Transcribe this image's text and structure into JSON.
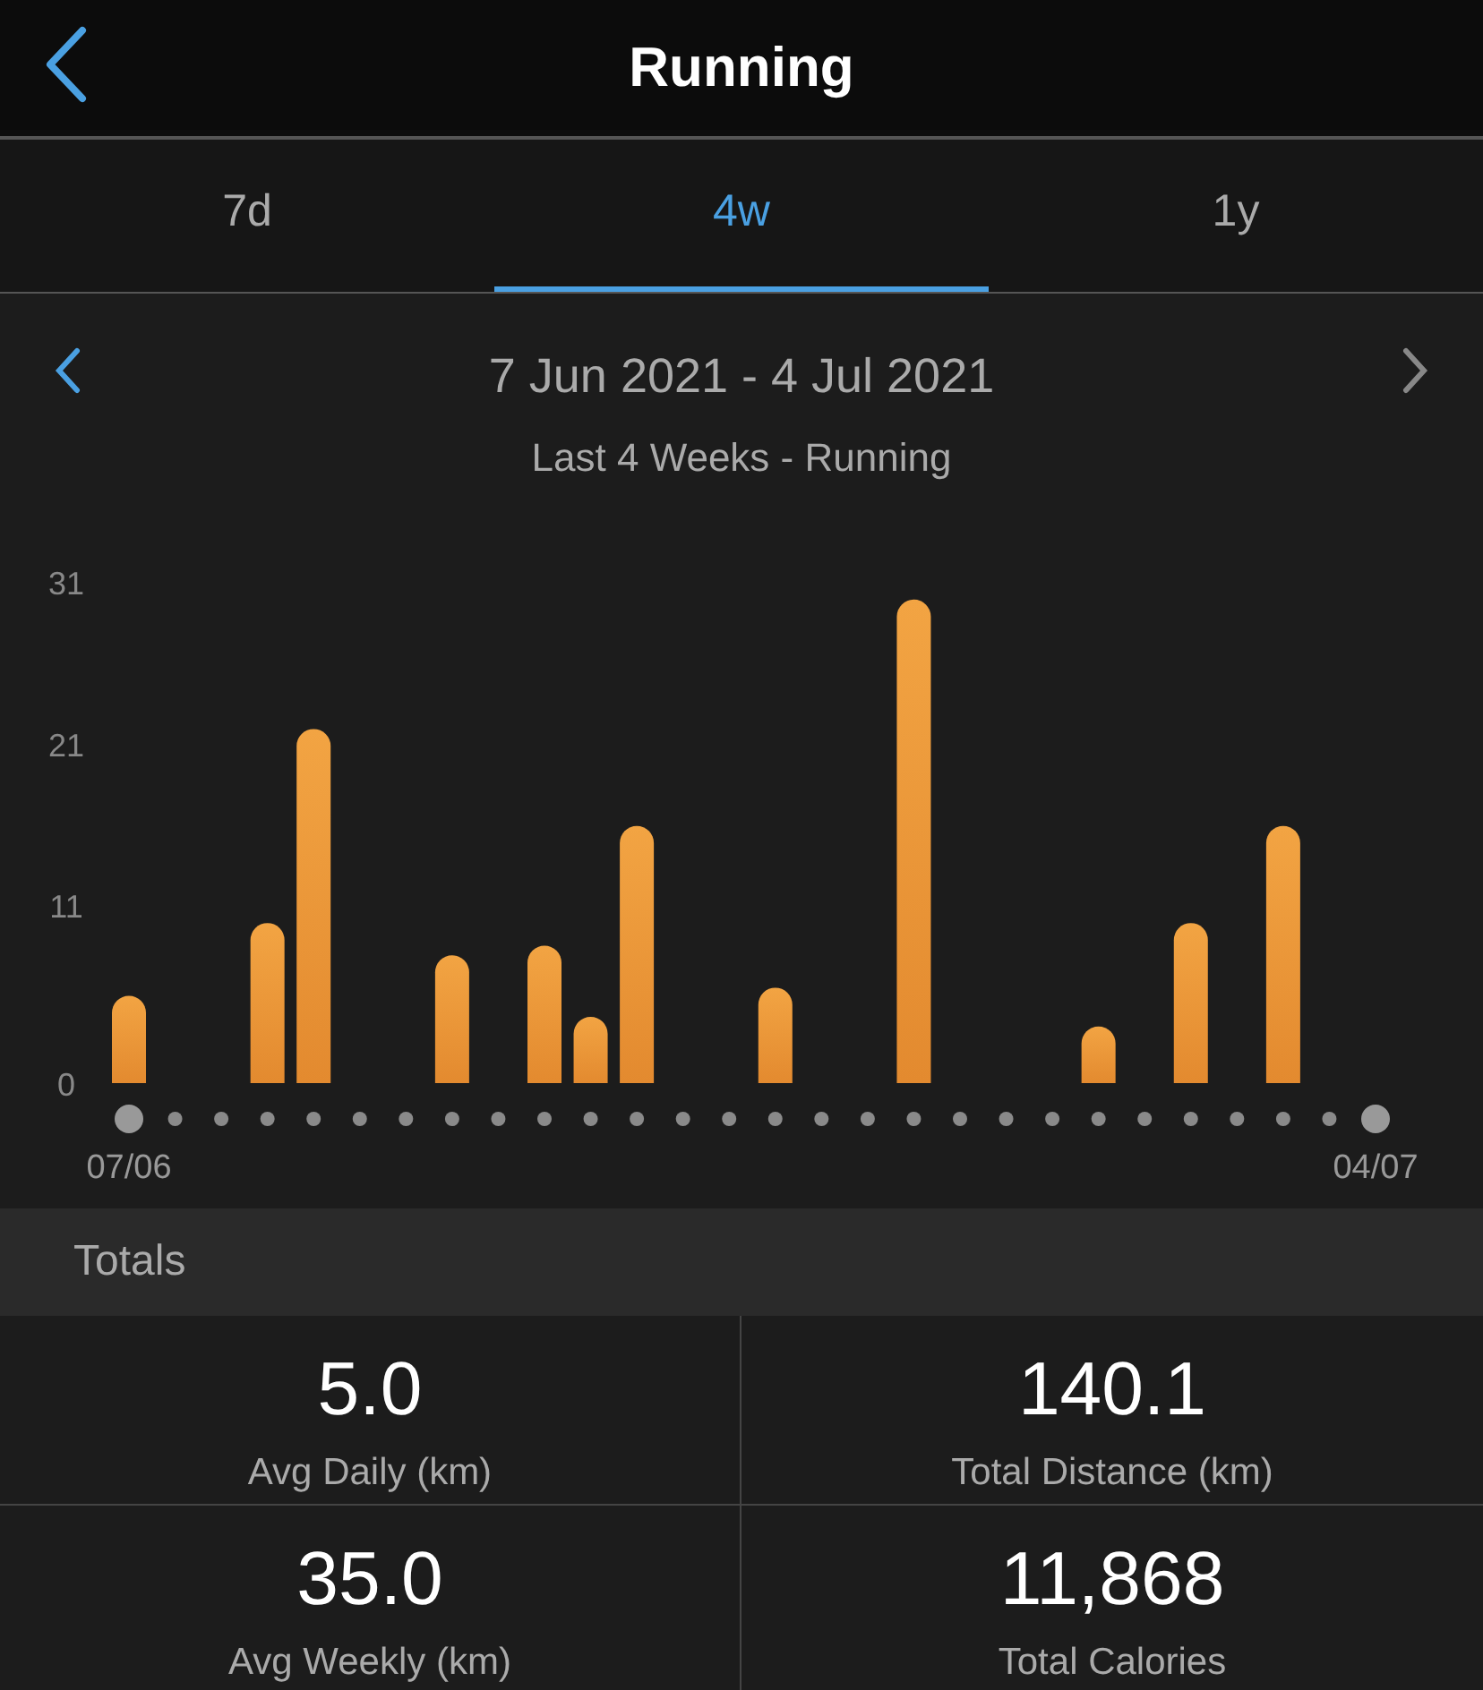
{
  "header": {
    "title": "Running"
  },
  "tabs": [
    {
      "label": "7d",
      "selected": false
    },
    {
      "label": "4w",
      "selected": true
    },
    {
      "label": "1y",
      "selected": false
    }
  ],
  "period": {
    "range": "7 Jun 2021 - 4 Jul 2021",
    "subtitle": "Last 4 Weeks - Running"
  },
  "chart_data": {
    "type": "bar",
    "categories": [
      "07/06",
      null,
      null,
      null,
      null,
      null,
      null,
      null,
      null,
      null,
      null,
      null,
      null,
      null,
      null,
      null,
      null,
      null,
      null,
      null,
      null,
      null,
      null,
      null,
      null,
      null,
      null,
      "04/07"
    ],
    "values": [
      5.4,
      null,
      null,
      9.9,
      21.9,
      null,
      null,
      7.9,
      null,
      8.5,
      4.1,
      15.9,
      null,
      null,
      5.9,
      null,
      null,
      29.9,
      null,
      null,
      null,
      3.5,
      null,
      9.9,
      null,
      15.9,
      null,
      null
    ],
    "ylim": [
      0,
      31
    ],
    "yticks": [
      0,
      11,
      21,
      31
    ]
  },
  "totals": {
    "heading": "Totals",
    "stats": [
      {
        "value": "5.0",
        "label": "Avg Daily (km)"
      },
      {
        "value": "140.1",
        "label": "Total Distance (km)"
      },
      {
        "value": "35.0",
        "label": "Avg Weekly (km)"
      },
      {
        "value": "11,868",
        "label": "Total Calories"
      }
    ]
  }
}
